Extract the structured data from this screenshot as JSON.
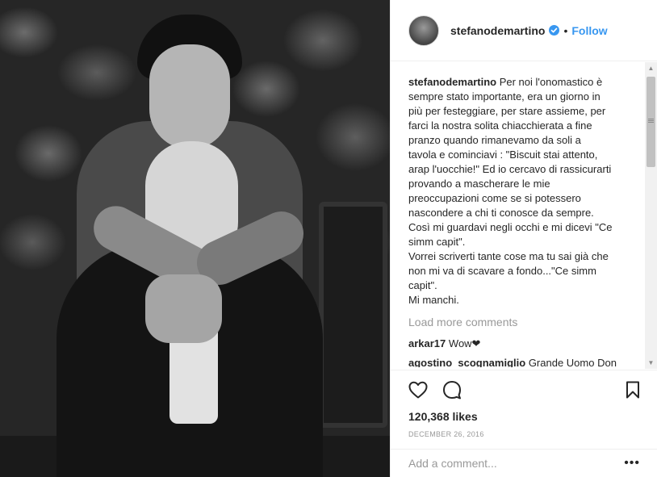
{
  "post": {
    "username": "stefanodemartino",
    "follow_label": "Follow",
    "separator": "•",
    "caption_lines": [
      "Per noi l'onomastico è",
      "sempre stato importante, era un giorno in",
      "più per festeggiare, per stare assieme, per",
      "farci la nostra solita chiacchierata a fine",
      "pranzo quando rimanevamo da soli a",
      "tavola e cominciavi : \"Biscuit stai attento,",
      "arap l'uocchie!\" Ed io cercavo di rassicurarti",
      "provando a mascherare le mie",
      "preoccupazioni come se si potessero",
      "nascondere a chi ti conosce da sempre.",
      "Così mi guardavi negli occhi e mi dicevi \"Ce",
      "simm capit\".",
      "Vorrei scriverti tante cose ma tu sai già che",
      "non mi va di scavare a fondo...\"Ce simm",
      "capit\".",
      "Mi manchi."
    ],
    "load_more": "Load more comments",
    "comments": [
      {
        "username": "arkar17",
        "text": "Wow❤"
      },
      {
        "username": "agostino_scognamiglio",
        "text": "Grande Uomo Don"
      }
    ],
    "likes": "120,368 likes",
    "date": "DECEMBER 26, 2016",
    "add_comment_placeholder": "Add a comment...",
    "more_options": "•••"
  },
  "icons": {
    "avatar": "profile-avatar",
    "verified": "verified-badge-icon",
    "like": "heart-icon",
    "comment": "comment-bubble-icon",
    "save": "bookmark-icon",
    "more": "ellipsis-icon"
  },
  "colors": {
    "link": "#3897f0",
    "verified": "#3897f0",
    "muted": "#999999",
    "text": "#262626"
  }
}
